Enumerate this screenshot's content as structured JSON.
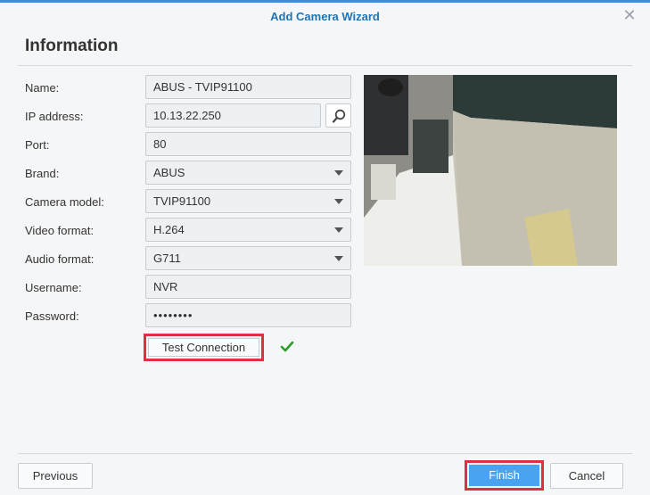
{
  "dialog": {
    "title": "Add Camera Wizard",
    "heading": "Information"
  },
  "form": {
    "name_label": "Name:",
    "name_value": "ABUS - TVIP91100",
    "ip_label": "IP address:",
    "ip_value": "10.13.22.250",
    "port_label": "Port:",
    "port_value": "80",
    "brand_label": "Brand:",
    "brand_value": "ABUS",
    "model_label": "Camera model:",
    "model_value": "TVIP91100",
    "video_label": "Video format:",
    "video_value": "H.264",
    "audio_label": "Audio format:",
    "audio_value": "G711",
    "username_label": "Username:",
    "username_value": "NVR",
    "password_label": "Password:",
    "password_value": "••••••••",
    "test_button": "Test Connection",
    "test_status": "success"
  },
  "footer": {
    "previous": "Previous",
    "finish": "Finish",
    "cancel": "Cancel"
  },
  "colors": {
    "accent": "#1f74b5",
    "finish_button": "#4aa3f0",
    "highlight_box": "#e03040",
    "success_check": "#2a9d2a"
  },
  "icons": {
    "close": "close-icon",
    "search": "search-icon",
    "dropdown": "chevron-down-icon",
    "status": "checkmark-icon"
  }
}
